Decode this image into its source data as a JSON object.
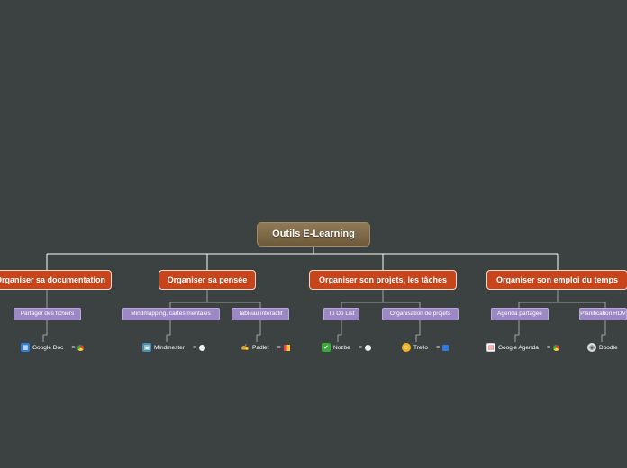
{
  "map": {
    "root": "Outils E-Learning",
    "categories": [
      {
        "label": "Organiser sa documentation"
      },
      {
        "label": "Organiser sa pensée"
      },
      {
        "label": "Organiser son projets, les tâches"
      },
      {
        "label": "Organiser son emploi du temps"
      }
    ],
    "subtopics": [
      {
        "label": "Partager des fichiers"
      },
      {
        "label": "Mindmapping, cartes mentales"
      },
      {
        "label": "Tableau interactif"
      },
      {
        "label": "To Do List"
      },
      {
        "label": "Organisation de projets"
      },
      {
        "label": "Agenda partagée"
      },
      {
        "label": "Planification RDV"
      }
    ],
    "leaves": [
      {
        "label": "Google Doc",
        "icon": "google-docs-icon",
        "extra": "chrome-icon"
      },
      {
        "label": "Mindmester",
        "icon": "map-icon",
        "extra": "globe-icon"
      },
      {
        "label": "Padlet",
        "icon": "pencil-icon",
        "extra": "app-icon"
      },
      {
        "label": "Nozbe",
        "icon": "check-icon",
        "extra": "globe-icon"
      },
      {
        "label": "Trello",
        "icon": "smiley-icon",
        "extra": "trello-icon"
      },
      {
        "label": "Google Agenda",
        "icon": "calendar-icon",
        "extra": "chrome-icon"
      },
      {
        "label": "Doodle",
        "icon": "doodle-icon",
        "extra": ""
      }
    ]
  }
}
